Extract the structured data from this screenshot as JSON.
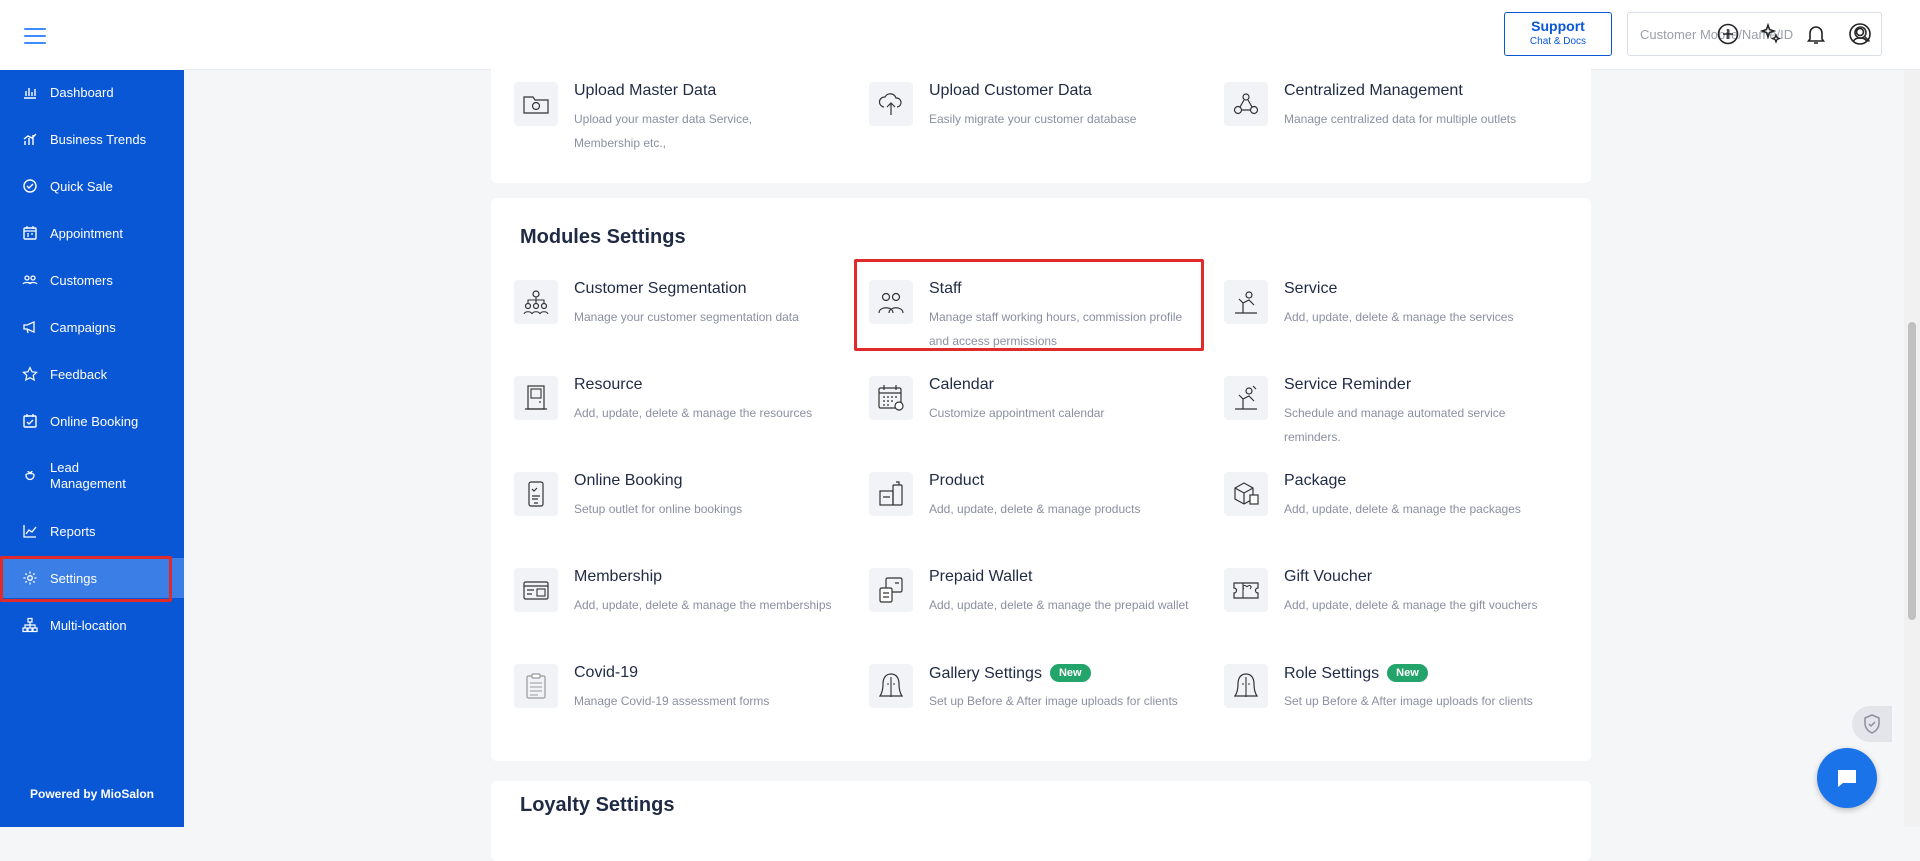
{
  "sidebar": {
    "items": [
      {
        "label": "Dashboard",
        "icon": "bar-chart-icon"
      },
      {
        "label": "Business Trends",
        "icon": "trend-bars-icon"
      },
      {
        "label": "Quick Sale",
        "icon": "check-circle-icon"
      },
      {
        "label": "Appointment",
        "icon": "calendar-icon"
      },
      {
        "label": "Customers",
        "icon": "users-icon"
      },
      {
        "label": "Campaigns",
        "icon": "megaphone-icon"
      },
      {
        "label": "Feedback",
        "icon": "star-icon"
      },
      {
        "label": "Online Booking",
        "icon": "calendar-check-icon"
      },
      {
        "label": "Lead Management",
        "icon": "lead-icon"
      },
      {
        "label": "Reports",
        "icon": "line-chart-icon"
      },
      {
        "label": "Settings",
        "icon": "gear-icon"
      },
      {
        "label": "Multi-location",
        "icon": "sitemap-icon"
      }
    ],
    "active": "Settings",
    "powered_by": "Powered by MioSalon"
  },
  "topbar": {
    "support_label": "Support",
    "support_sub": "Chat & Docs",
    "search_placeholder": "Customer Mobile/Name/ID"
  },
  "upload_section": {
    "tiles": [
      {
        "title": "Upload Master Data",
        "desc": "Upload your master data Service, Membership etc.,",
        "icon": "upload-folder-icon"
      },
      {
        "title": "Upload Customer Data",
        "desc": "Easily migrate your customer database",
        "icon": "cloud-upload-icon"
      },
      {
        "title": "Centralized Management",
        "desc": "Manage centralized data for multiple outlets",
        "icon": "network-icon"
      }
    ]
  },
  "modules_section": {
    "title": "Modules Settings",
    "tiles": [
      {
        "title": "Customer Segmentation",
        "desc": "Manage your customer segmentation data",
        "icon": "segmentation-icon"
      },
      {
        "title": "Staff",
        "desc": "Manage staff working hours, commission profile and access permissions",
        "icon": "staff-icon"
      },
      {
        "title": "Service",
        "desc": "Add, update, delete & manage the services",
        "icon": "service-icon"
      },
      {
        "title": "Resource",
        "desc": "Add, update, delete & manage the resources",
        "icon": "door-icon"
      },
      {
        "title": "Calendar",
        "desc": "Customize appointment calendar",
        "icon": "calendar-icon"
      },
      {
        "title": "Service Reminder",
        "desc": "Schedule and manage automated service reminders.",
        "icon": "reminder-icon"
      },
      {
        "title": "Online Booking",
        "desc": "Setup outlet for online bookings",
        "icon": "mobile-booking-icon"
      },
      {
        "title": "Product",
        "desc": "Add, update, delete & manage products",
        "icon": "product-icon"
      },
      {
        "title": "Package",
        "desc": "Add, update, delete & manage the packages",
        "icon": "package-icon"
      },
      {
        "title": "Membership",
        "desc": "Add, update, delete & manage the memberships",
        "icon": "membership-card-icon"
      },
      {
        "title": "Prepaid Wallet",
        "desc": "Add, update, delete & manage the prepaid wallet",
        "icon": "wallet-icon"
      },
      {
        "title": "Gift Voucher",
        "desc": "Add, update, delete & manage the gift vouchers",
        "icon": "gift-voucher-icon"
      },
      {
        "title": "Covid-19",
        "desc": "Manage Covid-19 assessment forms",
        "icon": "clipboard-icon"
      },
      {
        "title": "Gallery Settings",
        "desc": "Set up Before & After image uploads for clients",
        "icon": "gallery-face-icon",
        "badge": "New"
      },
      {
        "title": "Role Settings",
        "desc": "Set up Before & After image uploads for clients",
        "icon": "role-face-icon",
        "badge": "New"
      }
    ]
  },
  "loyalty_section": {
    "title": "Loyalty Settings"
  },
  "colors": {
    "sidebar_bg": "#0a57d6",
    "active_item_bg": "#3b7fe6",
    "highlight_red": "#e12a2a",
    "badge_green": "#23a46b"
  }
}
